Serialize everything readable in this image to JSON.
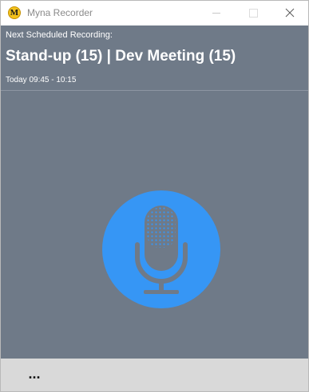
{
  "window": {
    "title": "Myna Recorder",
    "icon_letter": "M",
    "controls": [
      "minimize-icon",
      "maximize-icon",
      "close-icon"
    ]
  },
  "header": {
    "next_label": "Next Scheduled Recording:",
    "meeting_title": "Stand-up (15) | Dev Meeting (15)",
    "meeting_time": "Today 09:45 - 10:15"
  },
  "record": {
    "icon": "microphone-icon"
  },
  "bottom": {
    "more_label": "..."
  },
  "colors": {
    "background": "#6f7a88",
    "record_button": "#3696f5",
    "mic": "#6f7a88",
    "bottom_bar": "#d9d9d9",
    "app_icon": "#f3c21c"
  }
}
